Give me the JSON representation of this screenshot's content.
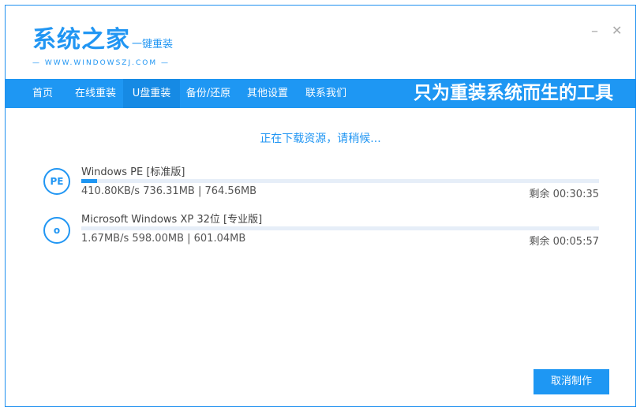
{
  "logo": {
    "title": "系统之家",
    "subtitle": "一键重装",
    "url": "— WWW.WINDOWSZJ.COM —"
  },
  "window": {
    "minimize": "–",
    "close": "✕"
  },
  "nav": {
    "items": [
      "首页",
      "在线重装",
      "U盘重装",
      "备份/还原",
      "其他设置",
      "联系我们"
    ],
    "active": "U盘重装",
    "slogan": "只为重装系统而生的工具"
  },
  "status": "正在下载资源，请稍候...",
  "downloads": [
    {
      "icon": "PE",
      "name": "Windows PE [标准版]",
      "progress_percent": 3,
      "info": "410.80KB/s 736.31MB | 764.56MB",
      "remaining": "剩余 00:30:35"
    },
    {
      "icon": "o",
      "name": "Microsoft Windows XP 32位 [专业版]",
      "progress_percent": 0,
      "info": "1.67MB/s 598.00MB | 601.04MB",
      "remaining": "剩余 00:05:57"
    }
  ],
  "cancel_button": "取消制作",
  "colors": {
    "accent": "#1e97f3"
  }
}
